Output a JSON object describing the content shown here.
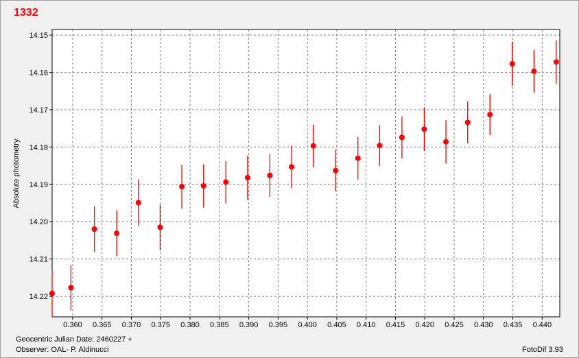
{
  "chart_data": {
    "type": "scatter",
    "title": "1332",
    "ylabel": "Absolute photometry",
    "xlabel": "",
    "y_inverted": true,
    "xlim": [
      0.3565,
      0.443
    ],
    "ylim": [
      14.1485,
      14.2255
    ],
    "x_ticks": [
      0.36,
      0.365,
      0.37,
      0.375,
      0.38,
      0.385,
      0.39,
      0.395,
      0.4,
      0.405,
      0.41,
      0.415,
      0.42,
      0.425,
      0.43,
      0.435,
      0.44
    ],
    "x_tick_labels": [
      "0.360",
      "0.365",
      "0.370",
      "0.375",
      "0.380",
      "0.385",
      "0.390",
      "0.395",
      "0.400",
      "0.405",
      "0.410",
      "0.415",
      "0.420",
      "0.425",
      "0.430",
      "0.435",
      "0.440"
    ],
    "y_ticks": [
      14.15,
      14.16,
      14.17,
      14.18,
      14.19,
      14.2,
      14.21,
      14.22
    ],
    "y_tick_labels": [
      "14.15",
      "14.16",
      "14.17",
      "14.18",
      "14.19",
      "14.20",
      "14.21",
      "14.22"
    ],
    "grid": true,
    "series": [
      {
        "color": "#ff0000",
        "x": [
          0.3565,
          0.3597,
          0.3637,
          0.3675,
          0.3712,
          0.3749,
          0.3786,
          0.3823,
          0.3861,
          0.3898,
          0.3936,
          0.3973,
          0.401,
          0.4048,
          0.4086,
          0.4123,
          0.4161,
          0.4199,
          0.4236,
          0.4273,
          0.4311,
          0.4349,
          0.4386,
          0.4424
        ],
        "y": [
          14.2192,
          14.2177,
          14.202,
          14.2031,
          14.1949,
          14.2015,
          14.1906,
          14.1904,
          14.1894,
          14.1882,
          14.1876,
          14.1853,
          14.1797,
          14.1863,
          14.183,
          14.1796,
          14.1774,
          14.1752,
          14.1786,
          14.1734,
          14.1713,
          14.1577,
          14.1597,
          14.1572
        ],
        "err": [
          0.0063,
          0.0061,
          0.0062,
          0.0061,
          0.0062,
          0.0061,
          0.0059,
          0.0058,
          0.0057,
          0.0059,
          0.0058,
          0.0057,
          0.0057,
          0.0056,
          0.0057,
          0.0055,
          0.0056,
          0.0058,
          0.0058,
          0.0056,
          0.0055,
          0.0059,
          0.0057,
          0.0058
        ]
      }
    ]
  },
  "footer": {
    "date_label": "Geocentric Julian Date: 2460227 +",
    "observer_label": "Observer: OAL- P. Aldinucci",
    "software_label": "FotoDif 3.93"
  }
}
